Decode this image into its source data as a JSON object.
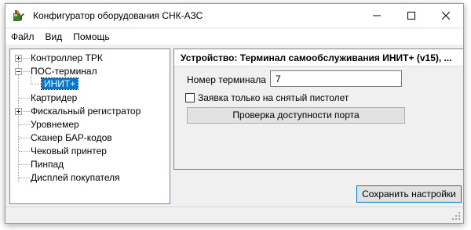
{
  "window": {
    "title": "Конфигуратор оборудования СНК-АЗС"
  },
  "menu": {
    "items": [
      "Файл",
      "Вид",
      "Помощь"
    ]
  },
  "tree": {
    "items": [
      {
        "label": "Контроллер ТРК",
        "expander": "plus"
      },
      {
        "label": "ПОС-терминал",
        "expander": "minus"
      },
      {
        "label": "ИНИТ+",
        "selected": true
      },
      {
        "label": "Картридер"
      },
      {
        "label": "Фискальный регистратор",
        "expander": "plus"
      },
      {
        "label": "Уровнемер"
      },
      {
        "label": "Сканер БАР-кодов"
      },
      {
        "label": "Чековый принтер"
      },
      {
        "label": "Пинпад"
      },
      {
        "label": "Дисплей покупателя"
      }
    ]
  },
  "panel": {
    "header": "Устройство: Терминал самообслуживания ИНИТ+ (v15), ...",
    "terminal_number_label": "Номер терминала",
    "terminal_number_value": "7",
    "checkbox_label": "Заявка только на снятый пистолет",
    "checkbox_checked": false,
    "port_check_button": "Проверка доступности порта"
  },
  "save_button": "Сохранить настройки",
  "colors": {
    "selection": "#0078d7",
    "window_bg": "#f0f0f0"
  }
}
